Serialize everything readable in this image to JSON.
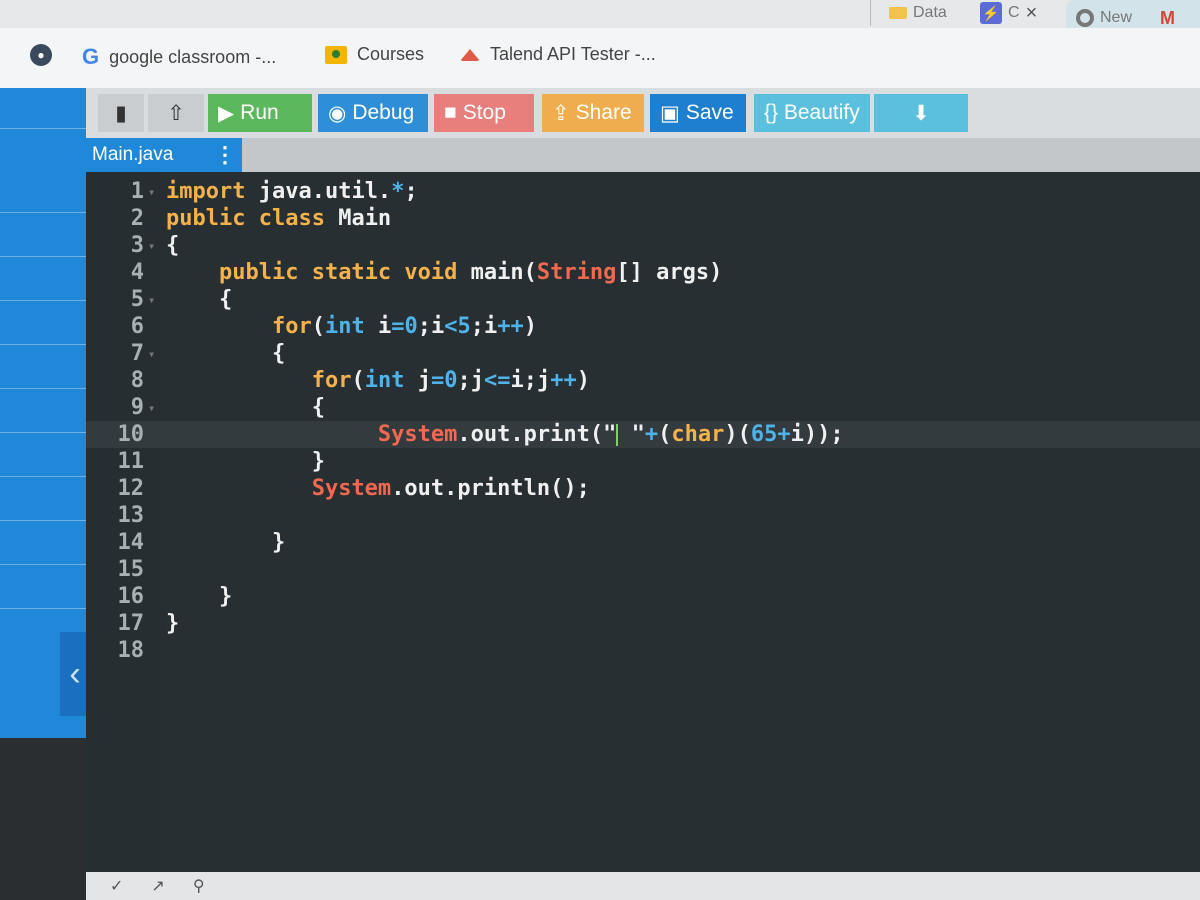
{
  "browser": {
    "tabs": [
      {
        "label": "Data",
        "icon": "folder-icon"
      },
      {
        "label": "C",
        "icon": "bolt-icon"
      },
      {
        "label": "New",
        "icon": "chrome-icon"
      },
      {
        "label": "M",
        "icon": "gmail-icon"
      }
    ],
    "tab_close": "×",
    "bookmarks": [
      {
        "label": "google classroom -...",
        "icon": "google-icon"
      },
      {
        "label": "Courses",
        "icon": "classroom-icon"
      },
      {
        "label": "Talend API Tester -...",
        "icon": "talend-icon"
      }
    ]
  },
  "toolbar": {
    "run": "Run",
    "debug": "Debug",
    "stop": "Stop",
    "share": "Share",
    "save": "Save",
    "beautify": "{} Beautify"
  },
  "file_tab": {
    "name": "Main.java"
  },
  "editor": {
    "active_line": 10,
    "lines": [
      {
        "n": "1",
        "fold": true
      },
      {
        "n": "2",
        "fold": false
      },
      {
        "n": "3",
        "fold": true
      },
      {
        "n": "4",
        "fold": false
      },
      {
        "n": "5",
        "fold": true
      },
      {
        "n": "6",
        "fold": false
      },
      {
        "n": "7",
        "fold": true
      },
      {
        "n": "8",
        "fold": false
      },
      {
        "n": "9",
        "fold": true
      },
      {
        "n": "10",
        "fold": false
      },
      {
        "n": "11",
        "fold": false
      },
      {
        "n": "12",
        "fold": false
      },
      {
        "n": "13",
        "fold": false
      },
      {
        "n": "14",
        "fold": false
      },
      {
        "n": "15",
        "fold": false
      },
      {
        "n": "16",
        "fold": false
      },
      {
        "n": "17",
        "fold": false
      },
      {
        "n": "18",
        "fold": false
      }
    ],
    "code": {
      "l1_kw": "import",
      "l1_rest": " java.util.",
      "l1_star": "*",
      "l1_end": ";",
      "l2_kw": "public class",
      "l2_rest": " Main",
      "l3": "{",
      "l4_kw": "public static void",
      "l4_rest": " main(",
      "l4_type": "String",
      "l4_end": "[] args)",
      "l5": "{",
      "l6_kw": "for",
      "l6_p1": "(",
      "l6_int": "int",
      "l6_p2": " i",
      "l6_eq": "=",
      "l6_n0": "0",
      "l6_p3": ";i",
      "l6_lt": "<",
      "l6_n5": "5",
      "l6_p4": ";i",
      "l6_pp": "++",
      "l6_end": ")",
      "l7": "{",
      "l8_kw": "for",
      "l8_p1": "(",
      "l8_int": "int",
      "l8_p2": " j",
      "l8_eq": "=",
      "l8_n0": "0",
      "l8_p3": ";j",
      "l8_le": "<=",
      "l8_p4": "i;j",
      "l8_pp": "++",
      "l8_end": ")",
      "l9": "{",
      "l10_cls": "System",
      "l10_p1": ".out.print(",
      "l10_str1": "\"",
      "l10_str2": " \"",
      "l10_plus": "+",
      "l10_p2": "(",
      "l10_char": "char",
      "l10_p3": ")(",
      "l10_n65": "65",
      "l10_plus2": "+",
      "l10_end": "i));",
      "l11": "}",
      "l12_cls": "System",
      "l12_rest": ".out.println();",
      "l14": "}",
      "l16": "}",
      "l17": "}"
    }
  },
  "statusbar": {
    "left": "✓",
    "mid": "↗",
    "right": "⚲"
  }
}
